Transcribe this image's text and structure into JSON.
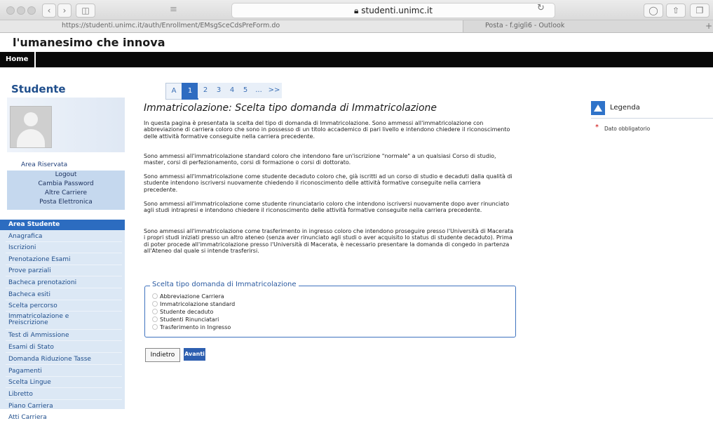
{
  "browser": {
    "url_domain": "studenti.unimc.it",
    "tab_active": "https://studenti.unimc.it/auth/Enrollment/EMsgSceCdsPreForm.do",
    "tab_other": "Posta - f.giglì6 - Outlook"
  },
  "site": {
    "slogan": "l'umanesimo che innova",
    "nav_home": "Home"
  },
  "sidebar": {
    "title": "Studente",
    "area_riservata": "Area Riservata",
    "riservata_items": [
      "Logout",
      "Cambia Password",
      "Altre Carriere",
      "Posta Elettronica"
    ],
    "menu_header": "Area Studente",
    "menu_items": [
      "Anagrafica",
      "Iscrizioni",
      "Prenotazione Esami",
      "Prove parziali",
      "Bacheca prenotazioni",
      "Bacheca esiti",
      "Scelta percorso",
      "Immatricolazione e",
      "Preiscrizione",
      "Test di Ammissione",
      "Esami di Stato",
      "Domanda Riduzione Tasse",
      "Pagamenti",
      "Scelta Lingue",
      "Libretto",
      "Piano Carriera",
      "Atti Carriera"
    ]
  },
  "pagination": [
    "A",
    "1",
    "2",
    "3",
    "4",
    "5",
    "...",
    ">>"
  ],
  "main": {
    "title": "Immatricolazione: Scelta tipo domanda di Immatricolazione",
    "paragraphs": [
      "In questa pagina è presentata la scelta del tipo di domanda di Immatricolazione. Sono ammessi all'immatricolazione con abbreviazione di carriera coloro che sono in possesso di un titolo accademico di pari livello e intendono chiedere il riconoscimento delle attività formative conseguite nella carriera precedente.",
      "Sono ammessi all'immatricolazione standard coloro che intendono fare un'iscrizione \"normale\" a un qualsiasi Corso di studio, master, corsi di perfezionamento, corsi di formazione o corsi di dottorato.",
      "Sono ammessi all'immatricolazione come studente decaduto coloro che, già iscritti ad un corso di studio e decaduti dalla qualità di studente intendono iscriversi nuovamente chiedendo il riconoscimento delle attività formative conseguite nella carriera precedente.",
      "Sono ammessi all'immatricolazione come studente rinunciatario coloro che intendono iscriversi nuovamente dopo aver rinunciato agli studi intrapresi e intendono chiedere il riconoscimento delle attività formative conseguite nella carriera precedente.",
      "Sono ammessi all'immatricolazione come trasferimento in ingresso coloro che intendono proseguire presso l'Università di Macerata i propri studi iniziati presso un altro ateneo (senza aver rinunciato agli studi o aver acquisito lo status di studente decaduto). Prima di poter procede all'immatricolazione presso l'Università di Macerata, è necessario presentare la domanda di congedo in partenza all'Ateneo dal quale si intende trasferirsi."
    ],
    "fieldset_legend": "Scelta tipo domanda di Immatricolazione",
    "options": [
      "Abbreviazione Carriera",
      "Immatricolazione standard",
      "Studente decaduto",
      "Studenti Rinunciatari",
      "Trasferimento in Ingresso"
    ],
    "btn_back": "Indietro",
    "btn_next": "Avanti"
  },
  "legend": {
    "title": "Legenda",
    "star": "*",
    "required": "Dato obbligatorio"
  }
}
